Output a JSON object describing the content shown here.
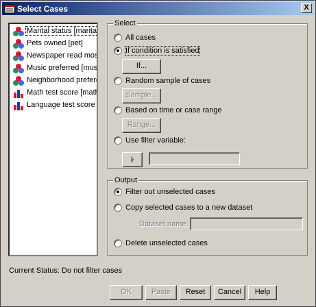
{
  "window": {
    "title": "Select Cases",
    "close_label": "X"
  },
  "variables": [
    {
      "label": "Marital status [marital]",
      "icon": "nominal-variable-icon",
      "selected": true
    },
    {
      "label": "Pets owned [pet]",
      "icon": "nominal-variable-icon"
    },
    {
      "label": "Newspaper read most",
      "icon": "nominal-variable-icon"
    },
    {
      "label": "Music preferred [music",
      "icon": "nominal-variable-icon"
    },
    {
      "label": "Neighborhood preferen",
      "icon": "nominal-variable-icon"
    },
    {
      "label": "Math test score [math]",
      "icon": "scale-variable-icon"
    },
    {
      "label": "Language test score [l",
      "icon": "scale-variable-icon"
    }
  ],
  "select": {
    "legend": "Select",
    "all_cases": "All cases",
    "if_condition": "If condition is satisfied",
    "if_button": "If...",
    "random_sample": "Random sample of cases",
    "sample_button": "Sample...",
    "time_range": "Based on time or case range",
    "range_button": "Range...",
    "filter_variable": "Use filter variable:",
    "filter_value": "",
    "selected_option": "If condition is satisfied"
  },
  "output": {
    "legend": "Output",
    "filter_out": "Filter out unselected cases",
    "copy_to_dataset": "Copy selected cases to a new dataset",
    "dataset_name_label": "Dataset name:",
    "dataset_name_value": "",
    "delete_unselected": "Delete unselected cases",
    "selected_option": "Filter out unselected cases"
  },
  "status": "Current Status: Do not filter cases",
  "buttons": {
    "ok": "OK",
    "paste": "Paste",
    "reset": "Reset",
    "cancel": "Cancel",
    "help": "Help"
  },
  "colors": {
    "titlebar_start": "#0a246a",
    "titlebar_end": "#a6caf0",
    "dialog_bg": "#d4d0c8",
    "list_bg": "#ffffff"
  }
}
